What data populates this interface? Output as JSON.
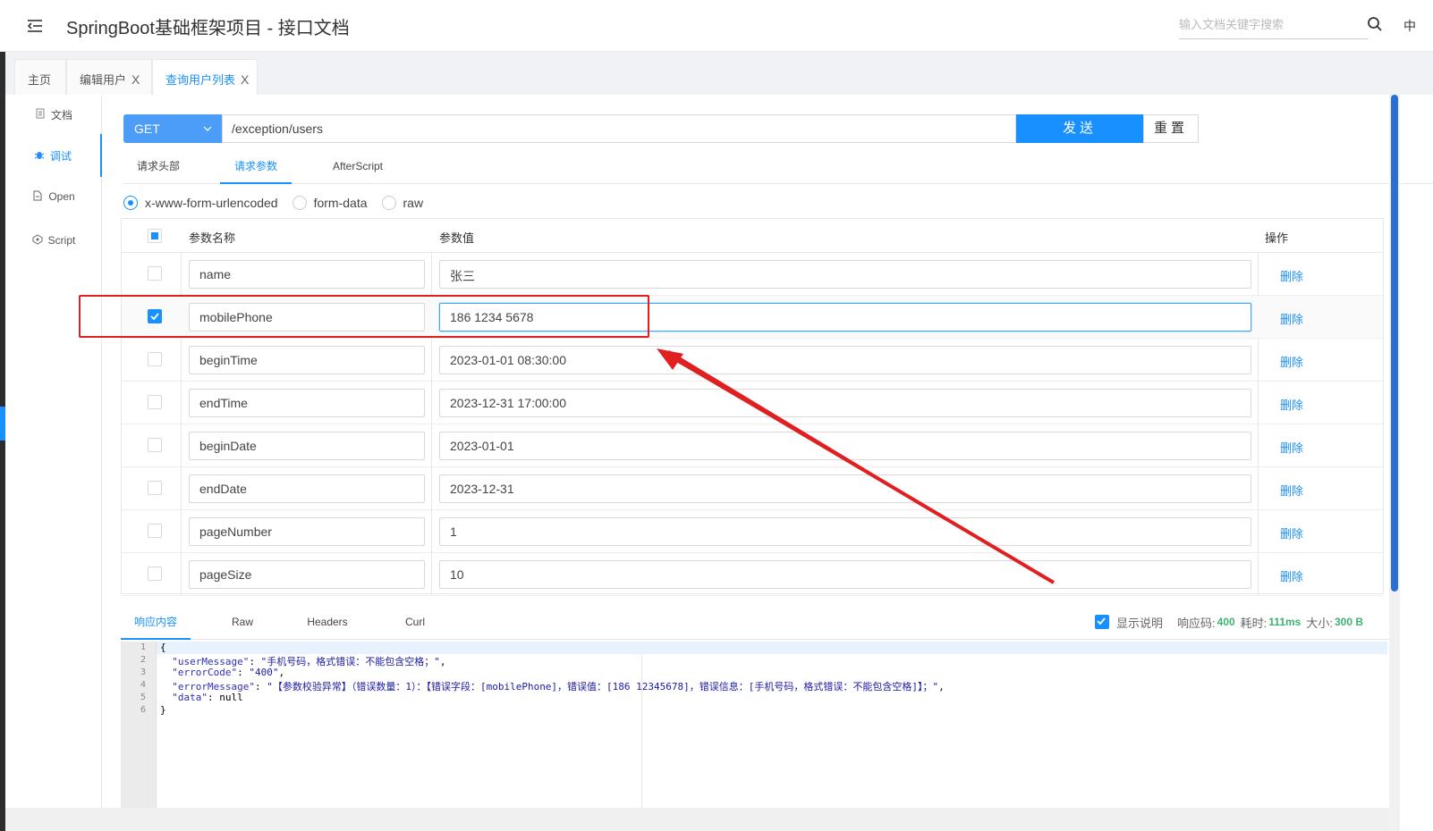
{
  "header": {
    "title": "SpringBoot基础框架项目 - 接口文档",
    "search_placeholder": "输入文档关键字搜索",
    "lang": "中"
  },
  "tabs": [
    {
      "label": "主页",
      "closable": false
    },
    {
      "label": "编辑用户",
      "closable": true
    },
    {
      "label": "查询用户列表",
      "closable": true,
      "active": true
    }
  ],
  "tab_close": "X",
  "sidebar": {
    "items": [
      {
        "label": "文档",
        "icon": "document-icon"
      },
      {
        "label": "调试",
        "icon": "bug-icon",
        "active": true
      },
      {
        "label": "Open",
        "icon": "file-icon"
      },
      {
        "label": "Script",
        "icon": "code-icon"
      }
    ]
  },
  "request": {
    "method": "GET",
    "url": "/exception/users",
    "send_label": "发送",
    "reset_label": "重置"
  },
  "subtabs": [
    "请求头部",
    "请求参数",
    "AfterScript"
  ],
  "content_types": [
    "x-www-form-urlencoded",
    "form-data",
    "raw"
  ],
  "param_table": {
    "headers": {
      "name": "参数名称",
      "value": "参数值",
      "action": "操作"
    },
    "delete_label": "删除",
    "rows": [
      {
        "name": "name",
        "value": "张三",
        "checked": false
      },
      {
        "name": "mobilePhone",
        "value": "186 1234 5678",
        "checked": true
      },
      {
        "name": "beginTime",
        "value": "2023-01-01 08:30:00",
        "checked": false
      },
      {
        "name": "endTime",
        "value": "2023-12-31 17:00:00",
        "checked": false
      },
      {
        "name": "beginDate",
        "value": "2023-01-01",
        "checked": false
      },
      {
        "name": "endDate",
        "value": "2023-12-31",
        "checked": false
      },
      {
        "name": "pageNumber",
        "value": "1",
        "checked": false
      },
      {
        "name": "pageSize",
        "value": "10",
        "checked": false
      }
    ]
  },
  "response": {
    "tabs": [
      "响应内容",
      "Raw",
      "Headers",
      "Curl"
    ],
    "show_desc_label": "显示说明",
    "status_label": "响应码:",
    "status_value": "400",
    "time_label": "耗时:",
    "time_value": "111ms",
    "size_label": "大小:",
    "size_value": "300 B",
    "line_numbers": [
      "1",
      "2",
      "3",
      "4",
      "5",
      "6"
    ],
    "code": {
      "l1": "{",
      "l2_key": "\"userMessage\"",
      "l2_val": "\"手机号码，格式错误：不能包含空格；\"",
      "l3_key": "\"errorCode\"",
      "l3_val": "\"400\"",
      "l4_key": "\"errorMessage\"",
      "l4_val": "\"【参数校验异常】（错误数量：1）：【错误字段：[mobilePhone]，错误值：[186 12345678]，错误信息：[手机号码，格式错误：不能包含空格]】；\"",
      "l5_key": "\"data\"",
      "l5_val": "null",
      "l6": "}"
    }
  },
  "colors": {
    "accent": "#1890ff",
    "annotation": "#e02020",
    "status_green": "#3cb371"
  }
}
